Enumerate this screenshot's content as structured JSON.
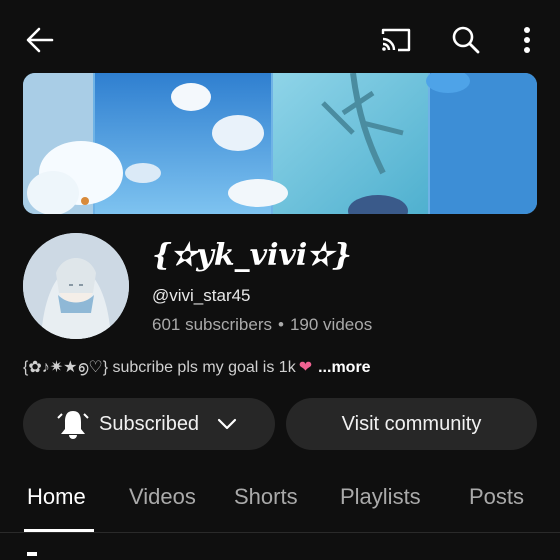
{
  "topbar": {
    "back_icon": "arrow-left-icon",
    "cast_icon": "cast-icon",
    "search_icon": "search-icon",
    "more_icon": "more-vert-icon"
  },
  "channel": {
    "name": "{✫yk_vivi✫}",
    "handle": "@vivi_star45",
    "subscribers": "601 subscribers",
    "videos": "190 videos",
    "stats_separator": "•",
    "description": "{✿♪✷★൭♡} subcribe pls my goal is 1k",
    "description_emoji": "❤",
    "more_label": "...more"
  },
  "actions": {
    "subscribed_label": "Subscribed",
    "visit_label": "Visit community"
  },
  "tabs": [
    {
      "label": "Home",
      "active": true
    },
    {
      "label": "Videos",
      "active": false
    },
    {
      "label": "Shorts",
      "active": false
    },
    {
      "label": "Playlists",
      "active": false
    },
    {
      "label": "Posts",
      "active": false
    }
  ],
  "colors": {
    "background": "#0f0f0f",
    "button_bg": "#272727",
    "secondary_text": "#aaaaaa"
  }
}
